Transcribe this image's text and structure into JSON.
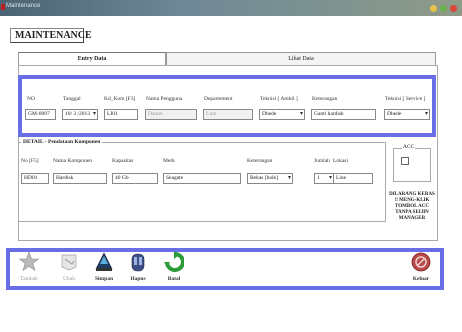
{
  "window": {
    "title": "Maintenance"
  },
  "form": {
    "title": "MAINTENANCE"
  },
  "tabs": [
    {
      "label": "Entry Data"
    },
    {
      "label": "Lihat Data"
    }
  ],
  "header_fields": {
    "no": {
      "label": "NO",
      "value": "GM-0007"
    },
    "tanggal": {
      "label": "Tanggal",
      "value": "10/ 3 /2013"
    },
    "kd_kom": {
      "label": "Kd_Kom [F3]",
      "value": "LI01"
    },
    "nama_pengguna": {
      "label": "Nama Pengguna",
      "value": "Daniel"
    },
    "departement": {
      "label": "Departement",
      "value": "Line"
    },
    "teknisi_ambil": {
      "label": "Teknisi [ Ambil ]",
      "value": "Dhede"
    },
    "keterangan": {
      "label": "Keterangan",
      "value": "Ganti hardisk"
    },
    "teknisi_service": {
      "label": "Teknisi [ Service ]",
      "value": "Dhede"
    }
  },
  "detail": {
    "title": "DETAIL - Pendataan Komponen",
    "no": {
      "label": "No [F5]",
      "value": "HD01"
    },
    "nama_komponen": {
      "label": "Nama Komponen",
      "value": "Hardisk"
    },
    "kapasitas": {
      "label": "Kapasitas",
      "value": "40 Gb"
    },
    "merk": {
      "label": "Merk",
      "value": "Seagate"
    },
    "keterangan": {
      "label": "Keterangan",
      "value": "Bekas [baik]"
    },
    "jumlah": {
      "label": "Jumlah",
      "value": "1"
    },
    "lokasi": {
      "label": "Lokasi",
      "value": "Line"
    }
  },
  "acc": {
    "label": "ACC",
    "checked": false,
    "warning": "DILARANG KERAS !! MENG-KLIK TOMBOL ACC TANPA SEIJIN MANAGER"
  },
  "toolbar": {
    "tambah": {
      "label": "Tambah",
      "icon": "star-icon",
      "enabled": false
    },
    "ubah": {
      "label": "Ubah",
      "icon": "edit-icon",
      "enabled": false
    },
    "simpan": {
      "label": "Simpan",
      "icon": "save-icon",
      "enabled": true
    },
    "hapus": {
      "label": "Hapus",
      "icon": "delete-icon",
      "enabled": true
    },
    "batal": {
      "label": "Batal",
      "icon": "refresh-icon",
      "enabled": true
    },
    "keluar": {
      "label": "Keluar",
      "icon": "exit-icon",
      "enabled": true
    }
  },
  "colors": {
    "panel_border": "#6a6ee6",
    "title_bar": "#5f7a89"
  }
}
